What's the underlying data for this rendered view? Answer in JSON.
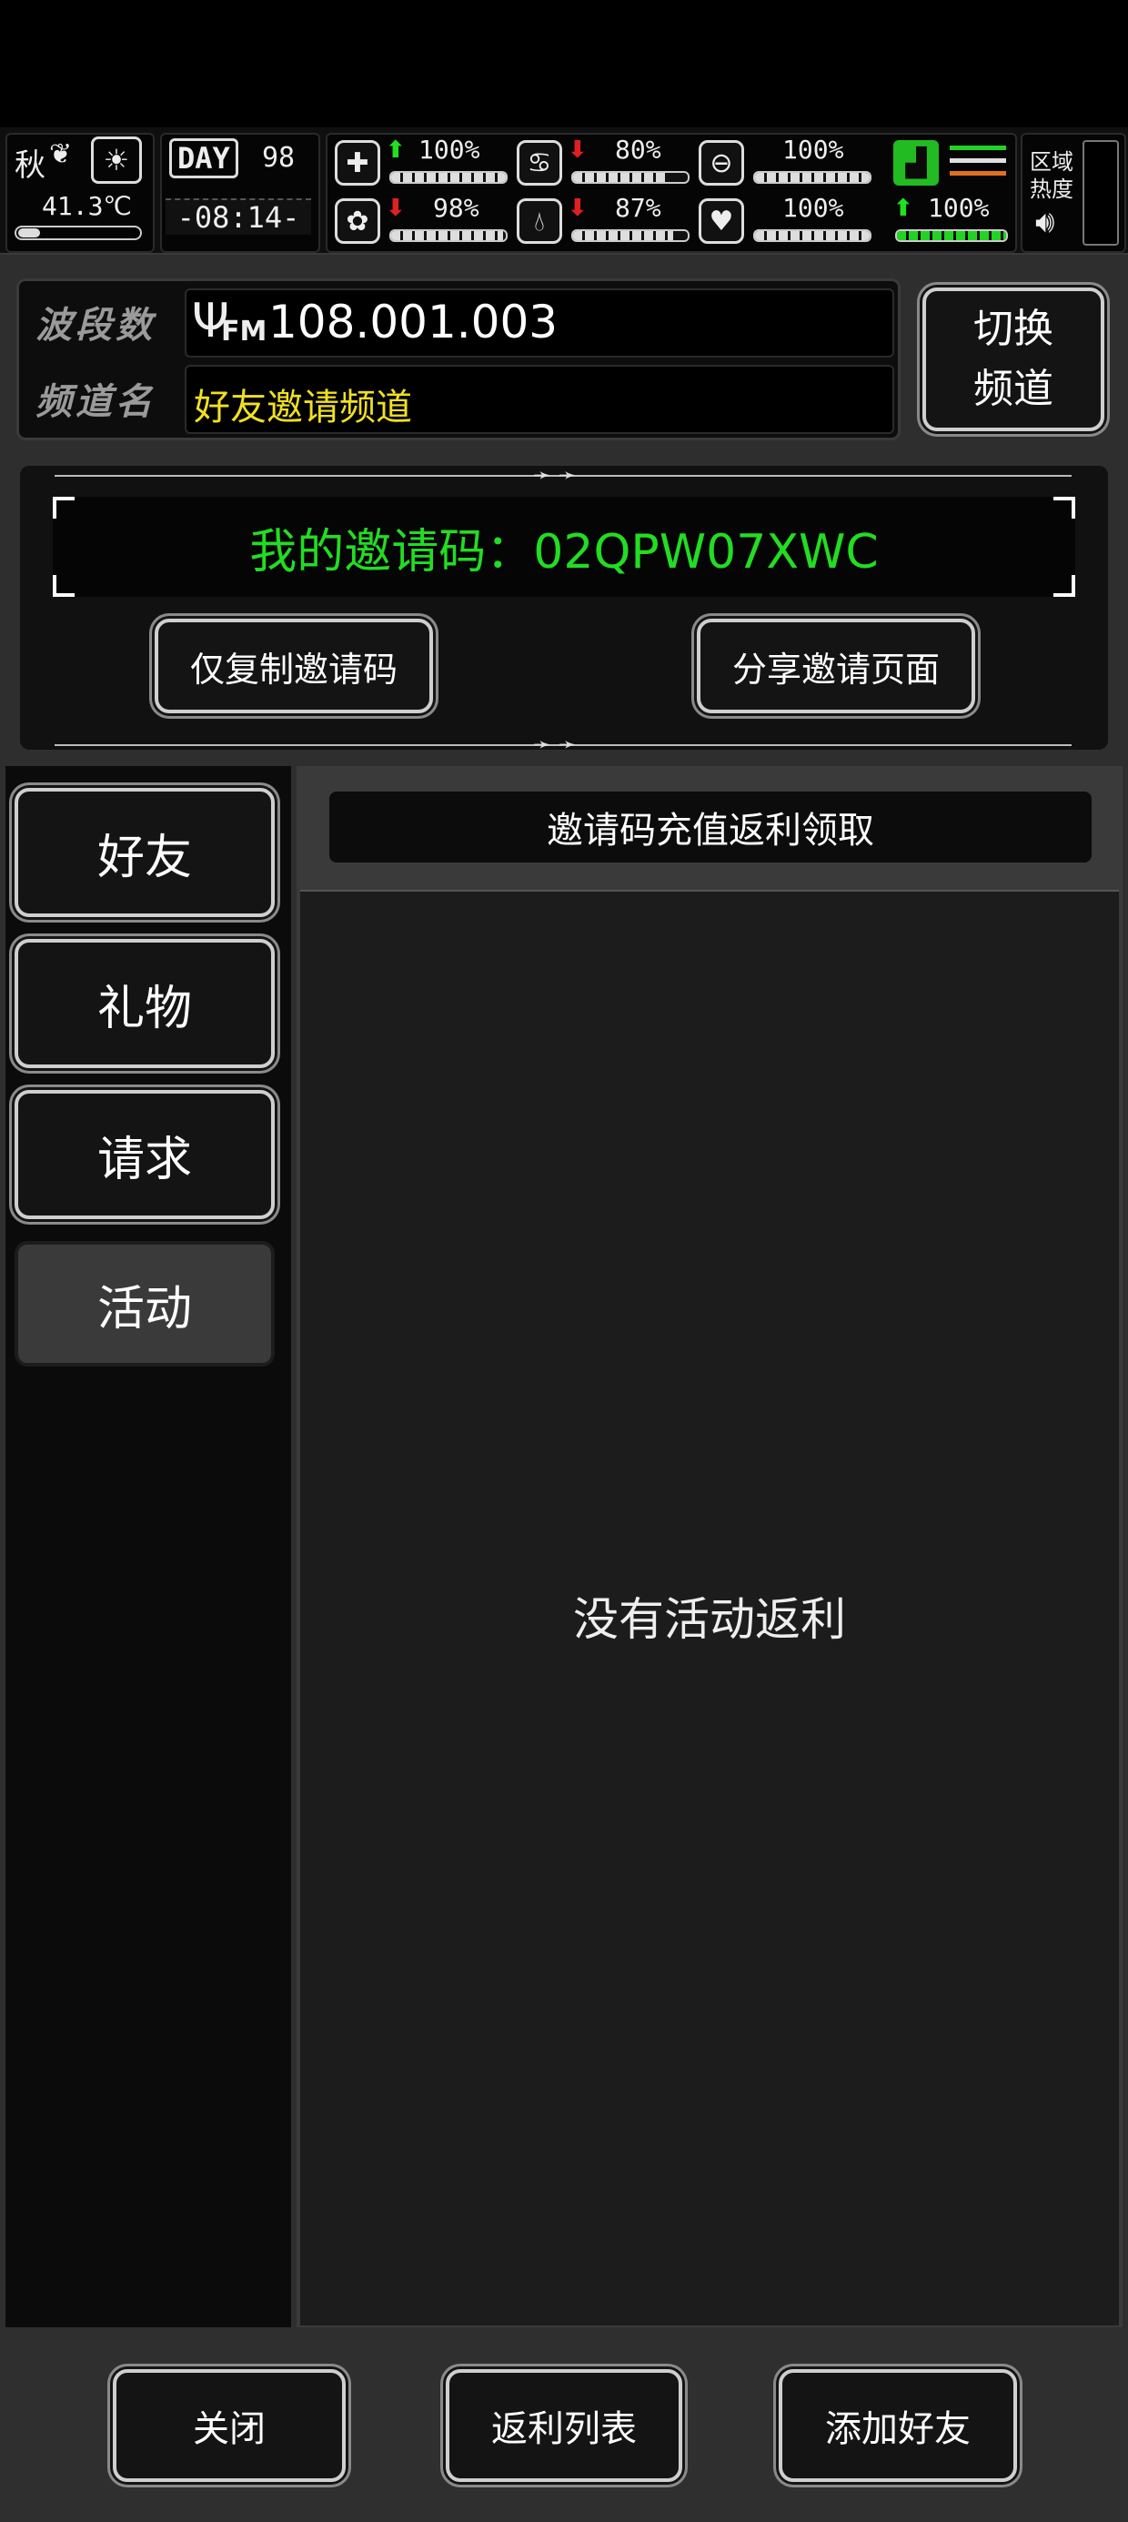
{
  "status": {
    "season": "秋",
    "temperature": "41.3℃",
    "day_label": "DAY",
    "day_number": "98",
    "clock": "-08:14-",
    "stats": [
      {
        "name": "health",
        "icon": "medkit-icon",
        "trend": "up",
        "value": "100%",
        "level": 1.0
      },
      {
        "name": "stomach",
        "icon": "stomach-icon",
        "trend": "down",
        "value": "80%",
        "level": 0.8
      },
      {
        "name": "pill",
        "icon": "pill-icon",
        "trend": "none",
        "value": "100%",
        "level": 1.0
      },
      {
        "name": "brain",
        "icon": "brain-icon",
        "trend": "down",
        "value": "98%",
        "level": 0.98
      },
      {
        "name": "water",
        "icon": "water-drop-icon",
        "trend": "down",
        "value": "87%",
        "level": 0.87
      },
      {
        "name": "heart",
        "icon": "heart-icon",
        "trend": "none",
        "value": "100%",
        "level": 1.0
      }
    ],
    "stamina": {
      "icon": "boot-icon",
      "trend": "up",
      "value": "100%",
      "level": 1.0
    },
    "region_heat_label_1": "区域",
    "region_heat_label_2": "热度",
    "colors": {
      "up": "#20e020",
      "down": "#e02020",
      "stamina_green": "#22d422",
      "orange": "#e07020"
    }
  },
  "radio": {
    "band_label": "波段数",
    "band_value": "108.001.003",
    "fm_label": "FM",
    "channel_label": "频道名",
    "channel_value": "好友邀请频道",
    "switch_button_line1": "切换",
    "switch_button_line2": "频道"
  },
  "invite": {
    "code_text": "我的邀请码：02QPW07XWC",
    "copy_button": "仅复制邀请码",
    "share_button": "分享邀请页面",
    "code_color": "#22dd22"
  },
  "tabs": [
    {
      "label": "好友",
      "active": false
    },
    {
      "label": "礼物",
      "active": false
    },
    {
      "label": "请求",
      "active": false
    },
    {
      "label": "活动",
      "active": true
    }
  ],
  "content": {
    "header": "邀请码充值返利领取",
    "empty_message": "没有活动返利"
  },
  "footer": {
    "close": "关闭",
    "rebate_list": "返利列表",
    "add_friend": "添加好友"
  }
}
